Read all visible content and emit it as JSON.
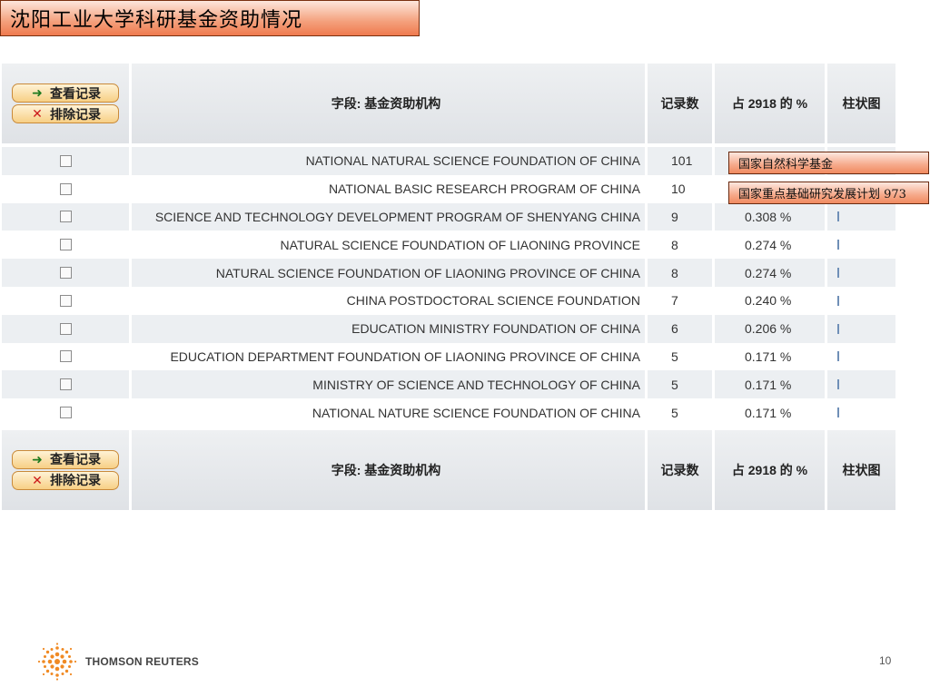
{
  "title": "沈阳工业大学科研基金资助情况",
  "header": {
    "view_records": "查看记录",
    "exclude_records": "排除记录",
    "field": "字段: 基金资助机构",
    "count": "记录数",
    "percent": "占 2918 的 %",
    "bar_chart": "柱状图"
  },
  "rows": [
    {
      "name": "NATIONAL NATURAL SCIENCE FOUNDATION OF CHINA",
      "count": "101",
      "percent": ""
    },
    {
      "name": "NATIONAL BASIC RESEARCH PROGRAM OF CHINA",
      "count": "10",
      "percent": ""
    },
    {
      "name": "SCIENCE AND TECHNOLOGY DEVELOPMENT PROGRAM OF SHENYANG CHINA",
      "count": "9",
      "percent": "0.308 %"
    },
    {
      "name": "NATURAL SCIENCE FOUNDATION OF LIAONING PROVINCE",
      "count": "8",
      "percent": "0.274 %"
    },
    {
      "name": "NATURAL SCIENCE FOUNDATION OF LIAONING PROVINCE OF CHINA",
      "count": "8",
      "percent": "0.274 %"
    },
    {
      "name": "CHINA POSTDOCTORAL SCIENCE FOUNDATION",
      "count": "7",
      "percent": "0.240 %"
    },
    {
      "name": "EDUCATION MINISTRY FOUNDATION OF CHINA",
      "count": "6",
      "percent": "0.206 %"
    },
    {
      "name": "EDUCATION DEPARTMENT FOUNDATION OF LIAONING PROVINCE OF CHINA",
      "count": "5",
      "percent": "0.171 %"
    },
    {
      "name": "MINISTRY OF SCIENCE AND TECHNOLOGY OF CHINA",
      "count": "5",
      "percent": "0.171 %"
    },
    {
      "name": "NATIONAL NATURE SCIENCE FOUNDATION OF CHINA",
      "count": "5",
      "percent": "0.171 %"
    }
  ],
  "callouts": [
    "国家自然科学基金",
    "国家重点基础研究发展计划 973"
  ],
  "footer": {
    "logo_text": "THOMSON REUTERS",
    "page_number": "10"
  },
  "icons": {
    "view": "arrow-right-icon",
    "exclude": "x-icon",
    "logo": "thomson-reuters-logo-icon"
  },
  "colors": {
    "title_bg": "#f4a07c",
    "header_bg": "#dfe2e6",
    "row_alt": "#eceff2",
    "bar": "#6f8fb7",
    "button_bg": "#f7cf85"
  }
}
